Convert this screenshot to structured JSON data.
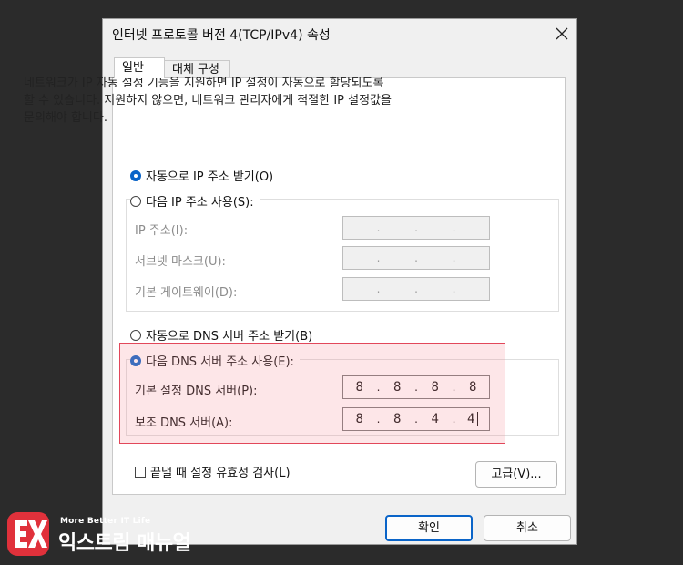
{
  "dialog": {
    "title": "인터넷 프로토콜 버전 4(TCP/IPv4) 속성",
    "close_icon": "close-icon"
  },
  "tabs": [
    {
      "label": "일반",
      "selected": true
    },
    {
      "label": "대체 구성",
      "selected": false
    }
  ],
  "description": [
    "네트워크가 IP 자동 설정 기능을 지원하면 IP 설정이 자동으로 할당되도록",
    "할 수 있습니다. 지원하지 않으면, 네트워크 관리자에게 적절한 IP 설정값을",
    "문의해야 합니다."
  ],
  "ip_mode": {
    "auto_label": "자동으로 IP 주소 받기(O)",
    "manual_label": "다음 IP 주소 사용(S):",
    "selected": "auto",
    "fields": [
      {
        "label": "IP 주소(I):",
        "value": [
          "",
          "",
          "",
          ""
        ]
      },
      {
        "label": "서브넷 마스크(U):",
        "value": [
          "",
          "",
          "",
          ""
        ]
      },
      {
        "label": "기본 게이트웨이(D):",
        "value": [
          "",
          "",
          "",
          ""
        ]
      }
    ]
  },
  "dns_mode": {
    "auto_label": "자동으로 DNS 서버 주소 받기(B)",
    "manual_label": "다음 DNS 서버 주소 사용(E):",
    "selected": "manual",
    "fields": [
      {
        "label": "기본 설정 DNS 서버(P):",
        "value": [
          "8",
          "8",
          "8",
          "8"
        ]
      },
      {
        "label": "보조 DNS 서버(A):",
        "value": [
          "8",
          "8",
          "4",
          "4"
        ]
      }
    ]
  },
  "validate_checkbox": {
    "label": "끝낼 때 설정 유효성 검사(L)",
    "checked": false
  },
  "buttons": {
    "advanced": "고급(V)...",
    "ok": "확인",
    "cancel": "취소"
  },
  "watermark": {
    "tagline": "More Better IT Life",
    "name": "익스트림 매뉴얼"
  },
  "colors": {
    "accent": "#0a64c8",
    "highlight_border": "#e2475a",
    "logo_red": "#e0313b"
  }
}
